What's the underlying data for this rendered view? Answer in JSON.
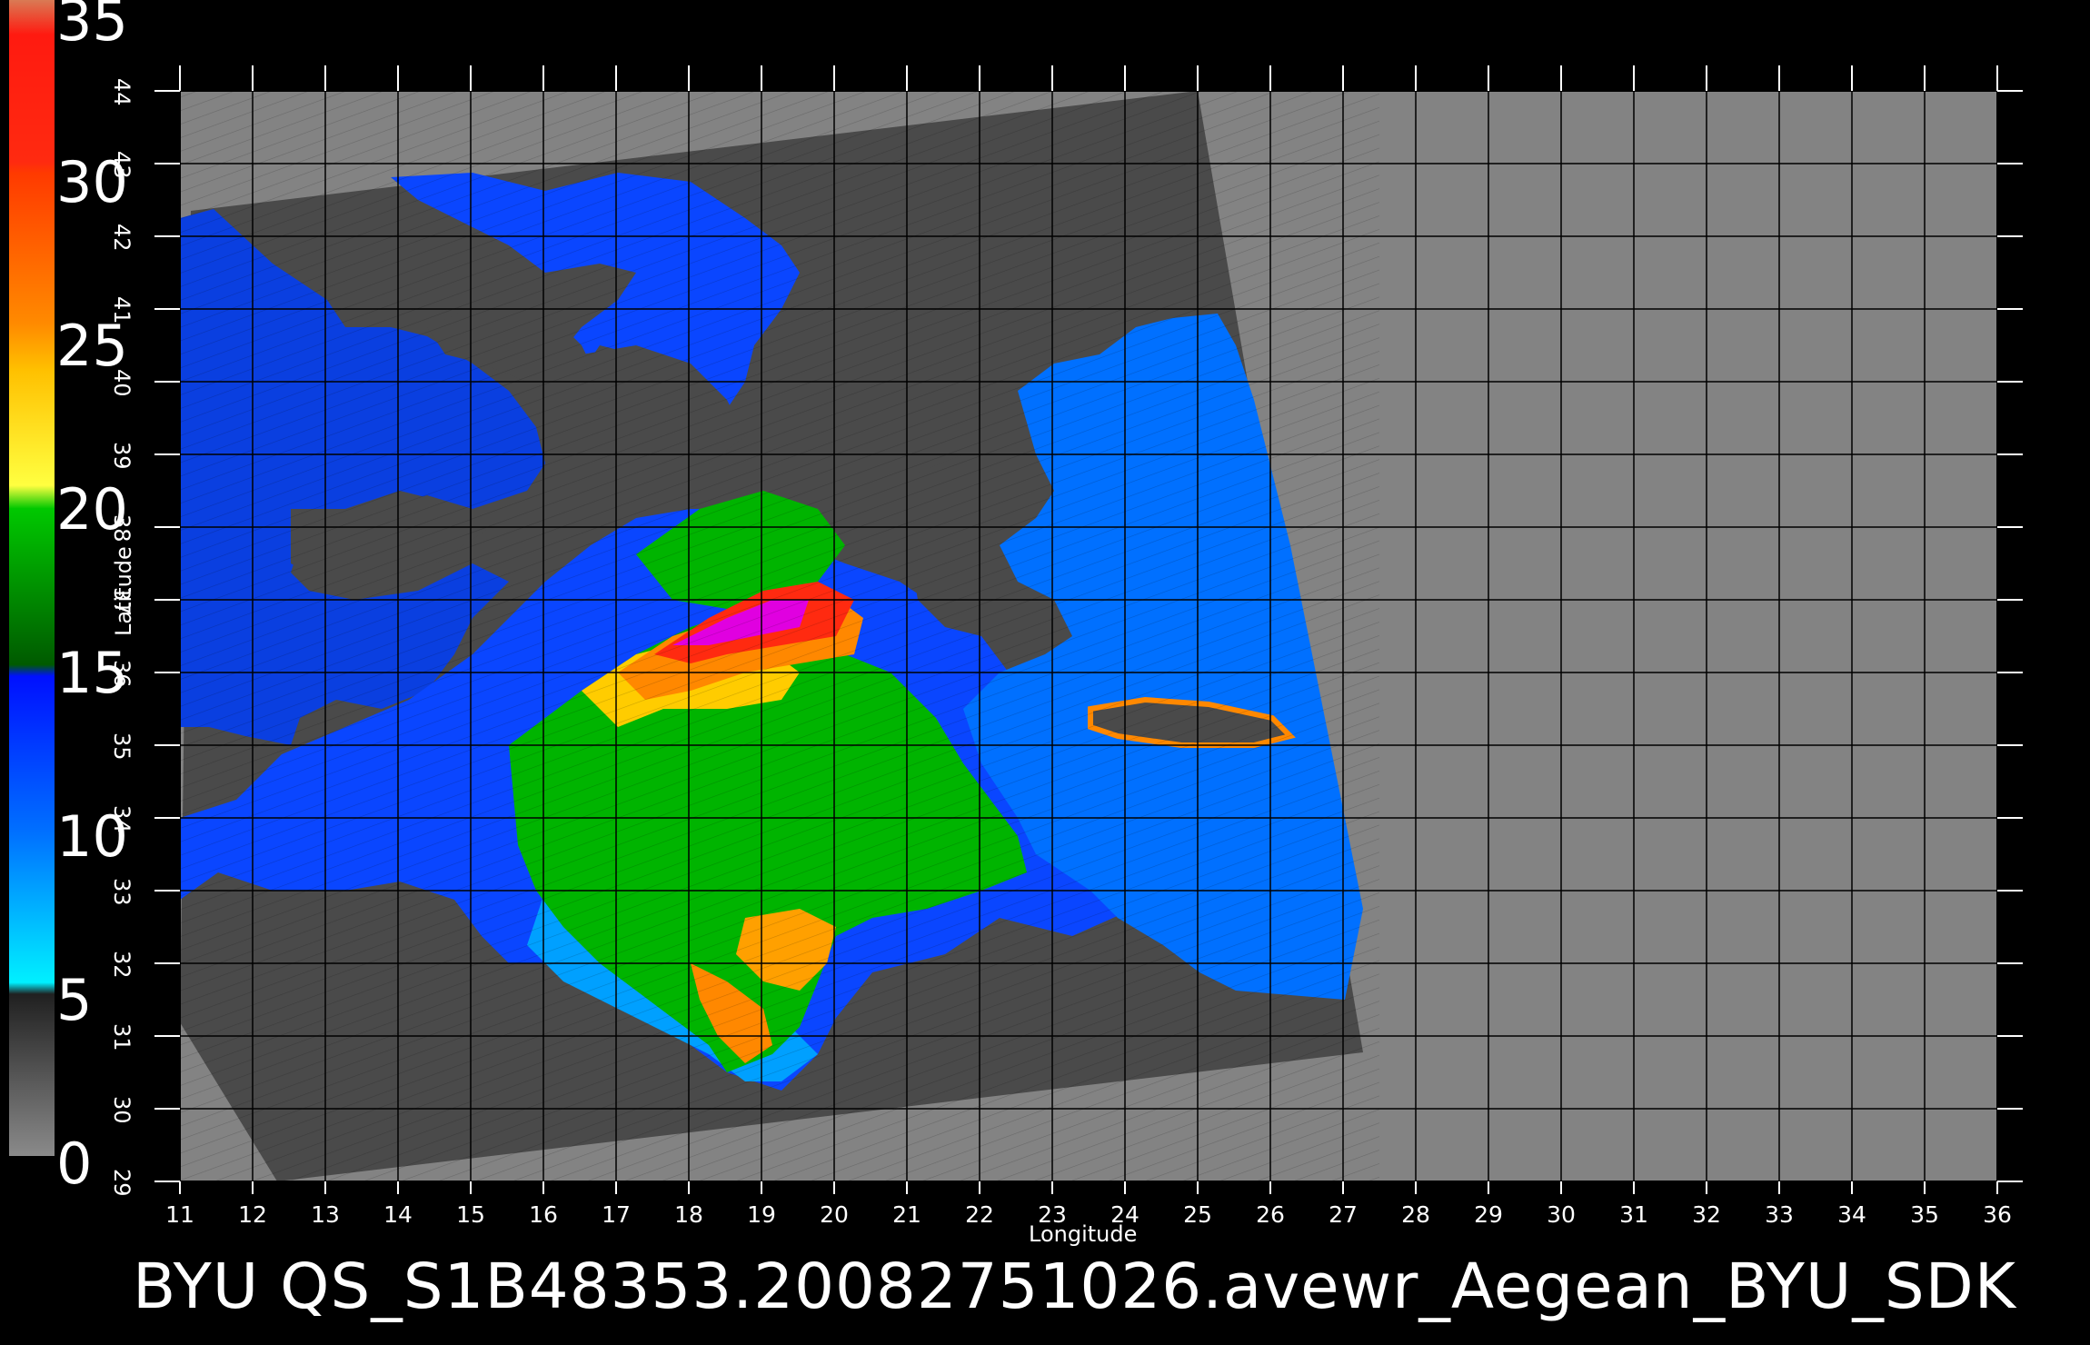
{
  "colorbar": {
    "labels": [
      "35",
      "30",
      "25",
      "20",
      "15",
      "10",
      "5",
      "0"
    ],
    "stops": [
      {
        "value": 35,
        "color": "#d97a54"
      },
      {
        "value": 32,
        "color": "#ff1a10"
      },
      {
        "value": 29,
        "color": "#ff4a00"
      },
      {
        "value": 26,
        "color": "#ff8c00"
      },
      {
        "value": 23,
        "color": "#ffd000"
      },
      {
        "value": 20,
        "color": "#ffff30"
      },
      {
        "value": 19.5,
        "color": "#00c000"
      },
      {
        "value": 15.2,
        "color": "#006000"
      },
      {
        "value": 14.8,
        "color": "#0010ff"
      },
      {
        "value": 10,
        "color": "#0080ff"
      },
      {
        "value": 5.3,
        "color": "#00f0ff"
      },
      {
        "value": 4.9,
        "color": "#202020"
      },
      {
        "value": 0,
        "color": "#8a8a8a"
      }
    ]
  },
  "axes": {
    "xlabel": "Longitude",
    "ylabel": "Latitude",
    "xticks": [
      "11",
      "12",
      "13",
      "14",
      "15",
      "16",
      "17",
      "18",
      "19",
      "20",
      "21",
      "22",
      "23",
      "24",
      "25",
      "26",
      "27",
      "28",
      "29",
      "30",
      "31",
      "32",
      "33",
      "34",
      "35",
      "36"
    ],
    "yticks": [
      "29",
      "30",
      "31",
      "32",
      "33",
      "34",
      "35",
      "36",
      "37",
      "38",
      "39",
      "40",
      "41",
      "42",
      "43",
      "44"
    ],
    "xlim": [
      11,
      36
    ],
    "ylim": [
      29,
      44
    ]
  },
  "caption": "BYU QS_S1B48353.20082751026.avewr_Aegean_BYU_SDK",
  "colors": {
    "background": "#000000",
    "land": "#838383",
    "swath": "#4a4a4a",
    "grid": "#000000"
  }
}
